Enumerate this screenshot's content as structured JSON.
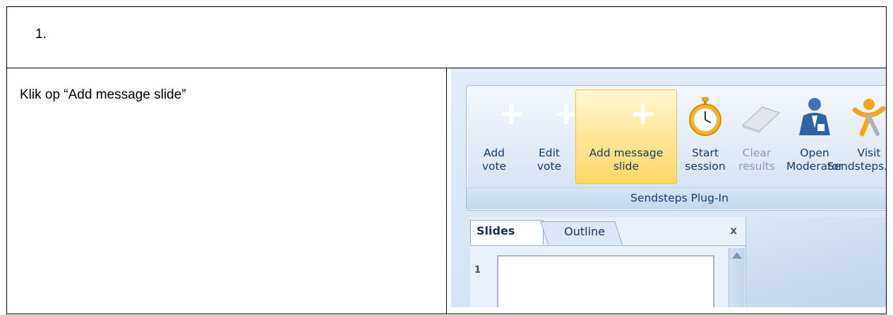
{
  "document": {
    "step_number": "1.",
    "instruction": "Klik op “Add message slide”"
  },
  "ribbon": {
    "group_label": "Sendsteps Plug-In",
    "buttons": [
      {
        "line1": "Add",
        "line2": "vote",
        "icon": "plus-orange-icon",
        "state": "normal"
      },
      {
        "line1": "Edit",
        "line2": "vote",
        "icon": "plus-orange-icon",
        "state": "normal"
      },
      {
        "line1": "Add message",
        "line2": "slide",
        "icon": "plus-blue-icon",
        "state": "active"
      },
      {
        "line1": "Start",
        "line2": "session",
        "icon": "stopwatch-icon",
        "state": "normal"
      },
      {
        "line1": "Clear",
        "line2": "results",
        "icon": "eraser-icon",
        "state": "disabled"
      },
      {
        "line1": "Open",
        "line2": "Moderator",
        "icon": "moderator-person-icon",
        "state": "normal"
      },
      {
        "line1": "Visit",
        "line2": "Sendsteps.com",
        "icon": "sendsteps-logo-icon",
        "state": "normal"
      }
    ]
  },
  "slides_pane": {
    "tabs": [
      "Slides",
      "Outline"
    ],
    "close_label": "x",
    "first_slide_number": "1"
  },
  "colors": {
    "ribbon_text": "#15396a",
    "active_button": "#ffe79a",
    "orange_icon": "#f6a20c",
    "blue_icon": "#1d69b9"
  }
}
